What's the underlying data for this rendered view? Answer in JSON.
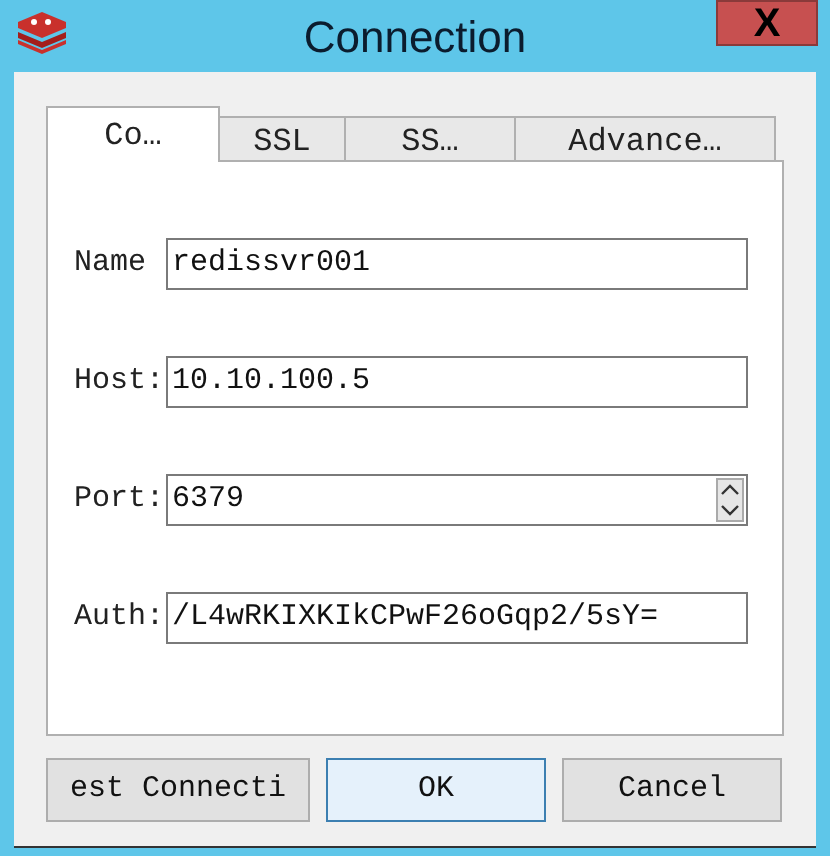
{
  "window": {
    "title": "Connection",
    "close": "X"
  },
  "tabs": [
    {
      "label": "Co…",
      "selected": true
    },
    {
      "label": "SSL",
      "selected": false
    },
    {
      "label": "SS…",
      "selected": false
    },
    {
      "label": "Advance…",
      "selected": false
    }
  ],
  "fields": [
    {
      "label": "Name",
      "value": "redissvr001",
      "kind": "text"
    },
    {
      "label": "Host:",
      "value": "10.10.100.5",
      "kind": "text"
    },
    {
      "label": "Port:",
      "value": "6379",
      "kind": "spin"
    },
    {
      "label": "Auth:",
      "value": "/L4wRKIXKIkCPwF26oGqp2/5sY=",
      "kind": "text"
    }
  ],
  "buttons": [
    {
      "label": "est Connecti",
      "selected": false
    },
    {
      "label": "OK",
      "selected": true
    },
    {
      "label": "Cancel",
      "selected": false
    }
  ]
}
